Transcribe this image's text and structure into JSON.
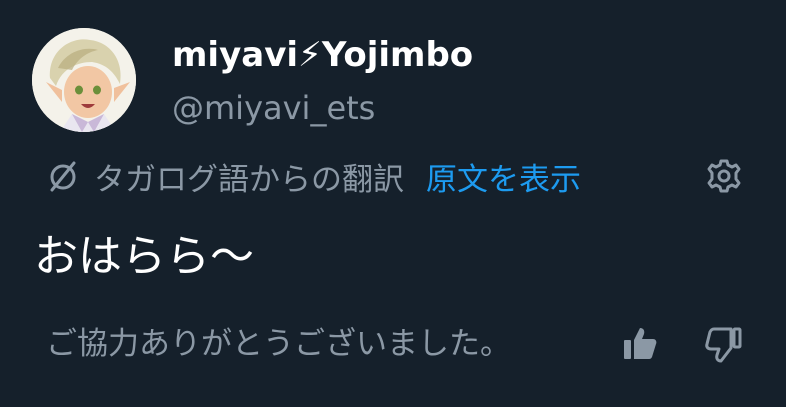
{
  "author": {
    "display_name": "miyavi⚡︎Yojimbo",
    "handle": "@miyavi_ets"
  },
  "translation": {
    "translated_from": "タガログ語からの翻訳",
    "show_original_label": "原文を表示"
  },
  "tweet": {
    "text": "おはらら〜"
  },
  "feedback": {
    "message": "ご協力ありがとうございました。"
  },
  "colors": {
    "background": "#15202b",
    "primary_text": "#ffffff",
    "secondary_text": "#8b98a5",
    "link": "#1d9bf0"
  },
  "icons": {
    "translate": "translate-icon",
    "settings": "gear-icon",
    "thumbs_up": "thumbs-up-icon",
    "thumbs_down": "thumbs-down-icon"
  }
}
